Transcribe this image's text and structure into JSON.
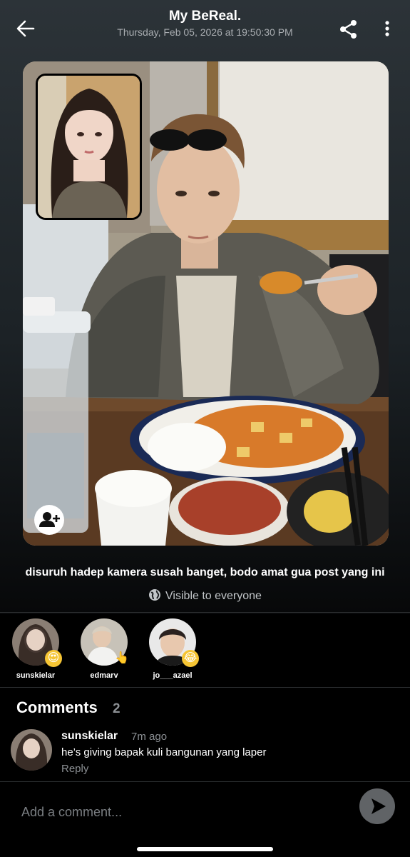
{
  "header": {
    "title": "My BeReal.",
    "timestamp": "Thursday, Feb 05, 2026 at 19:50:30 PM",
    "icons": {
      "back": "arrow-left-icon",
      "share": "share-icon",
      "more": "more-vertical-icon"
    }
  },
  "post": {
    "main_image": "photo of a young man in a camouflage jacket eating a spicy tofu rice dish",
    "selfie_image": "selfie of a young woman with long dark hair",
    "caption": "disuruh hadep kamera susah banget, bodo amat gua post yang ini",
    "visibility": "Visible to everyone",
    "visibility_icon": "globe-icon",
    "add_friend_icon": "add-person-icon"
  },
  "reactions": [
    {
      "username": "sunskielar",
      "emoji": "😍"
    },
    {
      "username": "edmarv",
      "emoji": "👆"
    },
    {
      "username": "jo___azael",
      "emoji": "😂"
    }
  ],
  "comments": {
    "title": "Comments",
    "count": "2",
    "items": [
      {
        "username": "sunskielar",
        "time": "7m ago",
        "text": "he’s giving bapak kuli bangunan yang laper",
        "reply_label": "Reply"
      }
    ]
  },
  "input": {
    "placeholder": "Add a comment...",
    "send_icon": "send-icon"
  },
  "colors": {
    "background": "#000000",
    "muted_text": "#8b8f93",
    "send_button": "#606366"
  }
}
